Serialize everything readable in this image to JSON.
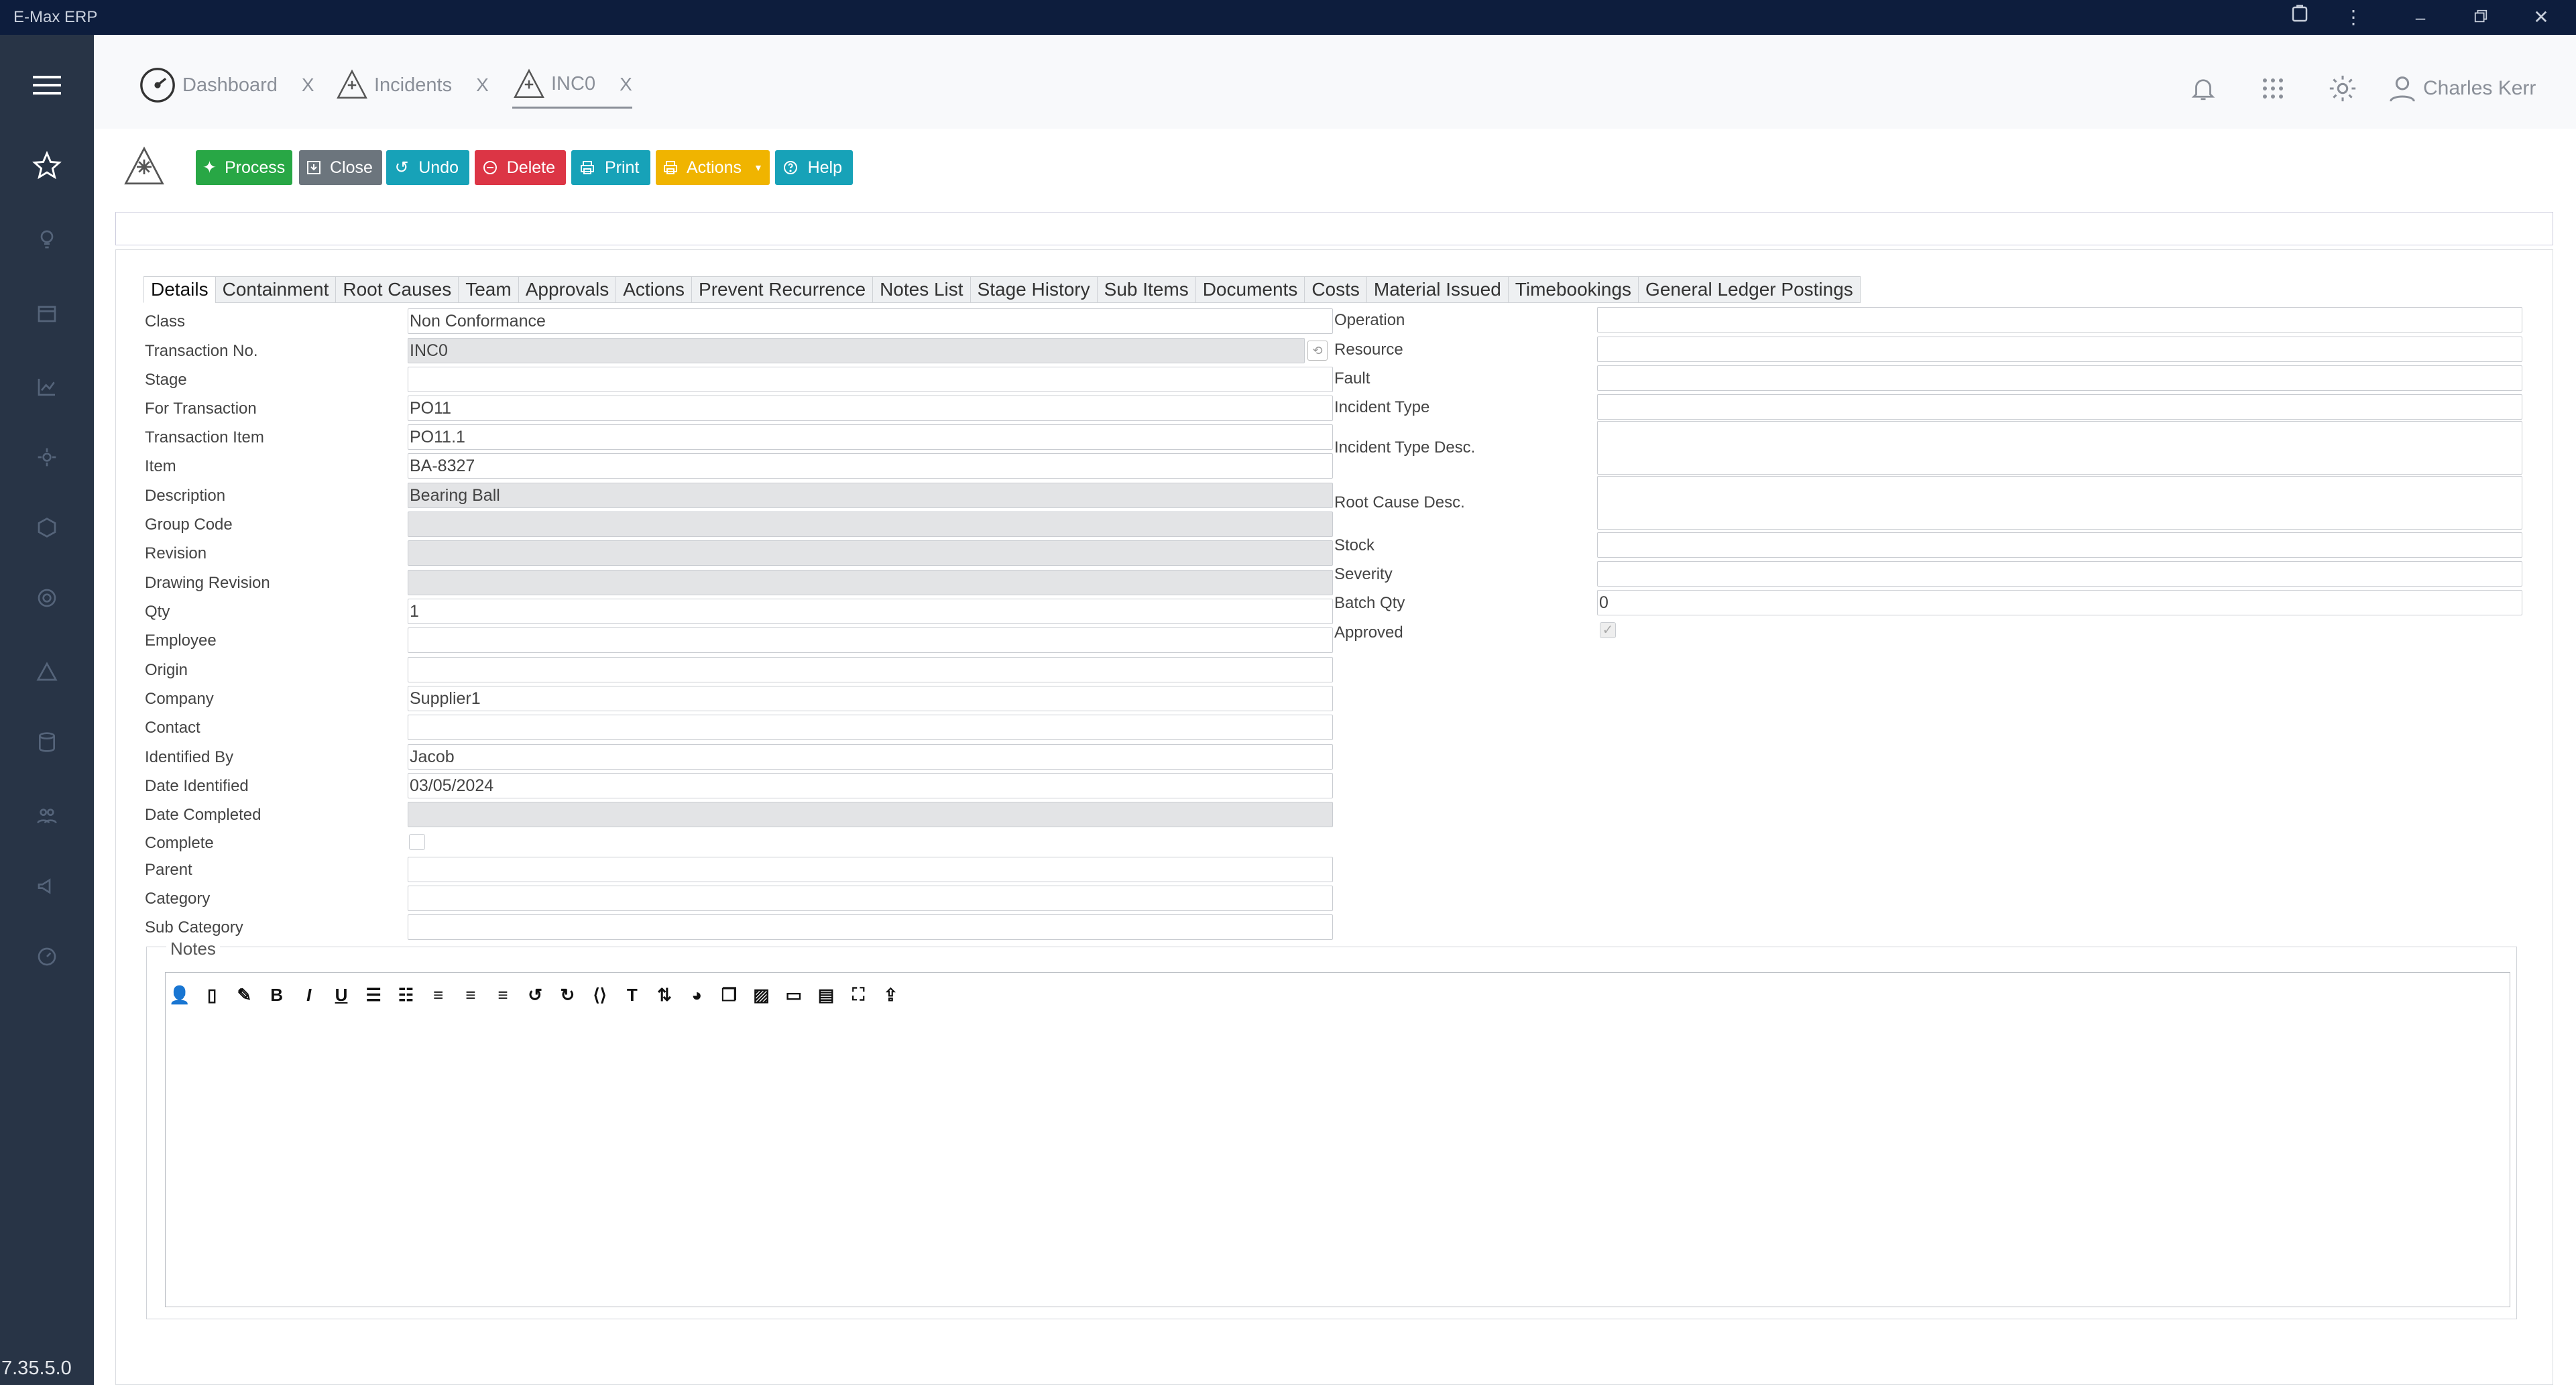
{
  "app": {
    "title": "E-Max ERP",
    "version": "7.35.5.0"
  },
  "header": {
    "tabs": [
      {
        "label": "Dashboard",
        "close": "X"
      },
      {
        "label": "Incidents",
        "close": "X"
      },
      {
        "label": "INC0",
        "close": "X"
      }
    ],
    "user": "Charles Kerr"
  },
  "toolbar": {
    "process": "Process",
    "close": "Close",
    "undo": "Undo",
    "delete": "Delete",
    "print": "Print",
    "actions": "Actions",
    "help": "Help",
    "colors": {
      "process": "#28a745",
      "close": "#6c757d",
      "undo": "#17a2b8",
      "delete": "#dc3545",
      "print": "#17a2b8",
      "actions": "#f0b400",
      "help": "#17a2b8"
    }
  },
  "form_tabs": [
    "Details",
    "Containment",
    "Root Causes",
    "Team",
    "Approvals",
    "Actions",
    "Prevent Recurrence",
    "Notes List",
    "Stage History",
    "Sub Items",
    "Documents",
    "Costs",
    "Material Issued",
    "Timebookings",
    "General Ledger Postings"
  ],
  "left_fields": [
    {
      "label": "Class",
      "value": "Non Conformance"
    },
    {
      "label": "Transaction No.",
      "value": "INC0"
    },
    {
      "label": "Stage",
      "value": ""
    },
    {
      "label": "For Transaction",
      "value": "PO11"
    },
    {
      "label": "Transaction Item",
      "value": "PO11.1"
    },
    {
      "label": "Item",
      "value": "BA-8327"
    },
    {
      "label": "Description",
      "value": "Bearing Ball"
    },
    {
      "label": "Group Code",
      "value": ""
    },
    {
      "label": "Revision",
      "value": ""
    },
    {
      "label": "Drawing Revision",
      "value": ""
    },
    {
      "label": "Qty",
      "value": "1"
    },
    {
      "label": "Employee",
      "value": ""
    },
    {
      "label": "Origin",
      "value": ""
    },
    {
      "label": "Company",
      "value": "Supplier1"
    },
    {
      "label": "Contact",
      "value": ""
    },
    {
      "label": "Identified By",
      "value": "Jacob"
    },
    {
      "label": "Date Identified",
      "value": "03/05/2024"
    },
    {
      "label": "Date Completed",
      "value": ""
    },
    {
      "label": "Complete",
      "value": ""
    },
    {
      "label": "Parent",
      "value": ""
    },
    {
      "label": "Category",
      "value": ""
    },
    {
      "label": "Sub Category",
      "value": ""
    }
  ],
  "right_fields": [
    {
      "label": "Operation",
      "value": ""
    },
    {
      "label": "Resource",
      "value": ""
    },
    {
      "label": "Fault",
      "value": ""
    },
    {
      "label": "Incident Type",
      "value": ""
    },
    {
      "label": "Incident Type Desc.",
      "value": ""
    },
    {
      "label": "Root Cause Desc.",
      "value": ""
    },
    {
      "label": "Stock",
      "value": ""
    },
    {
      "label": "Severity",
      "value": ""
    },
    {
      "label": "Batch Qty",
      "value": "0"
    },
    {
      "label": "Approved",
      "value": "✓"
    }
  ],
  "notes": {
    "legend": "Notes",
    "bold": "B",
    "italic": "I",
    "underline": "U",
    "text": "T"
  }
}
